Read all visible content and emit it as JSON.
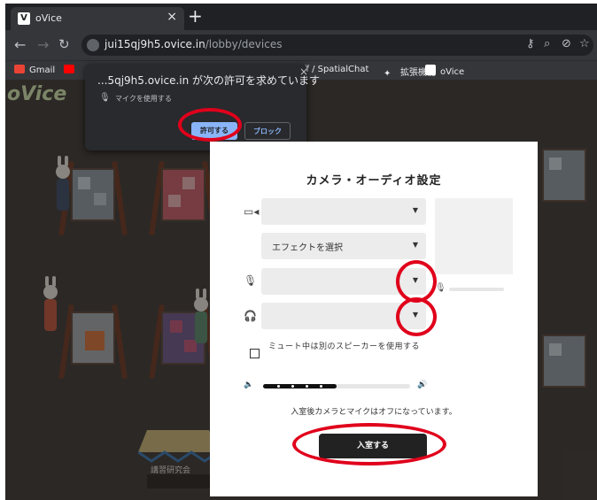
{
  "browser": {
    "tab_favicon": "V",
    "tab_title": "oVice",
    "tab_close": "×",
    "new_tab": "+",
    "url_host": "jui15qj9h5.ovice.in",
    "url_path": "/lobby/devices",
    "nav_icons": [
      "back-arrow-icon",
      "forward-arrow-icon",
      "reload-icon"
    ],
    "bookmarks": [
      {
        "label": "Gmail",
        "icon": "gmail-icon",
        "color": "#ea4335"
      },
      {
        "label": "",
        "icon": "youtube-icon",
        "color": "#ff0000"
      },
      {
        "label": "ff / SpatialChat",
        "icon": "",
        "color": ""
      },
      {
        "label": "拡張機能",
        "icon": "puzzle-icon",
        "color": "#e8eaed"
      },
      {
        "label": "oVice",
        "icon": "ovice-icon",
        "color": "#ffffff"
      }
    ]
  },
  "space": {
    "logo": "oVice",
    "tent_sign": "講習研究会"
  },
  "permission": {
    "title": "...5qj9h5.ovice.in が次の許可を求めています",
    "close": "×",
    "item": "マイクを使用する",
    "allow": "許可する",
    "block": "ブロック"
  },
  "dialog": {
    "title": "カメラ・オーディオ設定",
    "camera_select": "",
    "effect_select": "エフェクトを選択",
    "mic_select": "",
    "speaker_select": "",
    "checkbox_label": "ミュート中は別のスピーカーを使用する",
    "volume_fraction": 0.5,
    "notice": "入室後カメラとマイクはオフになっています。",
    "enter_button": "入室する"
  },
  "colors": {
    "annotation": "#e0001b",
    "allow_button": "#8ab4f8",
    "enter_button": "#222222"
  }
}
